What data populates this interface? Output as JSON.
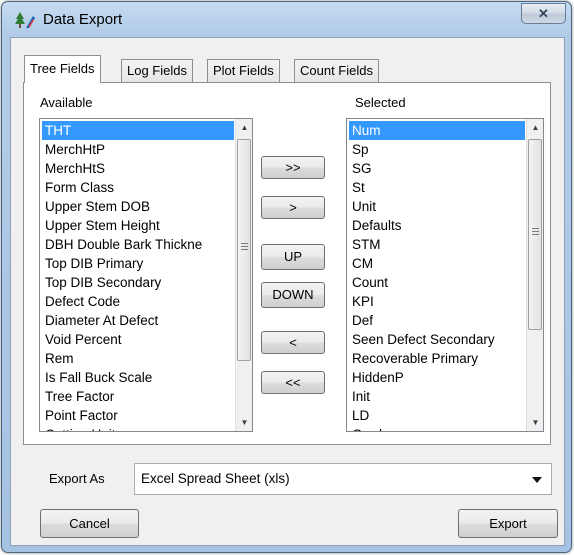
{
  "window": {
    "title": "Data Export",
    "close_glyph": "✕"
  },
  "tabs": [
    {
      "label": "Tree Fields",
      "active": true
    },
    {
      "label": "Log Fields",
      "active": false
    },
    {
      "label": "Plot Fields",
      "active": false
    },
    {
      "label": "Count Fields",
      "active": false
    }
  ],
  "available": {
    "label": "Available",
    "items": [
      "THT",
      "MerchHtP",
      "MerchHtS",
      "Form Class",
      "Upper Stem DOB",
      "Upper Stem Height",
      "DBH Double Bark Thickne",
      "Top DIB Primary",
      "Top DIB Secondary",
      "Defect Code",
      "Diameter At Defect",
      "Void Percent",
      "Rem",
      "Is Fall Buck Scale",
      "Tree Factor",
      "Point Factor",
      "Cutting Unit"
    ],
    "selected_item": "THT"
  },
  "selected": {
    "label": "Selected",
    "items": [
      "Num",
      "Sp",
      "SG",
      "St",
      "Unit",
      "Defaults",
      "STM",
      "CM",
      "Count",
      "KPI",
      "Def",
      "Seen Defect Secondary",
      "Recoverable Primary",
      "HiddenP",
      "Init",
      "LD",
      "Grade"
    ],
    "selected_item": "Num"
  },
  "move_buttons": {
    "add_all": ">>",
    "add": ">",
    "up": "UP",
    "down": "DOWN",
    "remove": "<",
    "remove_all": "<<"
  },
  "export": {
    "label": "Export As",
    "value": "Excel Spread Sheet (xls)"
  },
  "footer": {
    "cancel": "Cancel",
    "export": "Export"
  },
  "colors": {
    "selection": "#3399ff",
    "title_bg": "#b2cce8"
  }
}
